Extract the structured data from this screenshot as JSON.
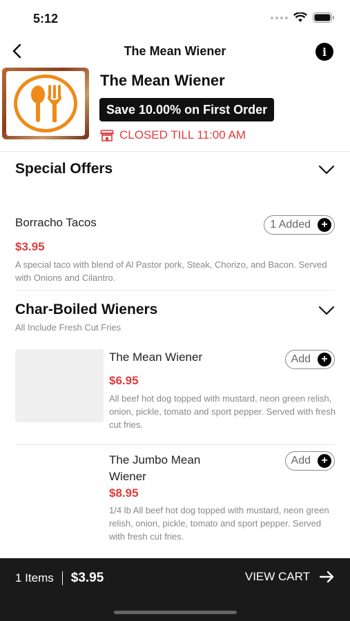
{
  "status_bar": {
    "time": "5:12"
  },
  "nav": {
    "title": "The Mean Wiener"
  },
  "store": {
    "name": "The Mean Wiener",
    "promo": "Save 10.00% on First Order",
    "closed_text": "CLOSED TILL 11:00 AM"
  },
  "sections": [
    {
      "title": "Special Offers",
      "subtitle": "",
      "items": [
        {
          "name": "Borracho Tacos",
          "price": "$3.95",
          "description": "A special taco with blend of Al Pastor pork, Steak, Chorizo, and Bacon.  Served with Onions and Cilantro.",
          "button_label": "1 Added"
        }
      ]
    },
    {
      "title": "Char-Boiled Wieners",
      "subtitle": "All Include Fresh Cut Fries",
      "items": [
        {
          "name": "The Mean Wiener",
          "price": "$6.95",
          "description": "All beef hot dog topped with mustard, neon green relish, onion, pickle, tomato and sport pepper.  Served with fresh cut fries.",
          "button_label": "Add"
        },
        {
          "name": "The Jumbo Mean Wiener",
          "price": "$8.95",
          "description": "1/4 lb All beef hot dog topped with mustard,  neon green relish, onion, pickle, tomato and sport pepper.  Served with fresh cut fries.",
          "button_label": "Add"
        }
      ]
    }
  ],
  "cart": {
    "items_label": "1 Items",
    "total": "$3.95",
    "view_cart_label": "VIEW CART"
  },
  "colors": {
    "accent_red": "#e23b3b",
    "logo_orange": "#f08a18",
    "bar_dark": "#1a1a1a"
  },
  "icons": [
    "back-arrow-icon",
    "info-icon",
    "wifi-icon",
    "battery-icon",
    "store-icon",
    "chevron-down-icon",
    "plus-icon",
    "arrow-right-icon"
  ]
}
